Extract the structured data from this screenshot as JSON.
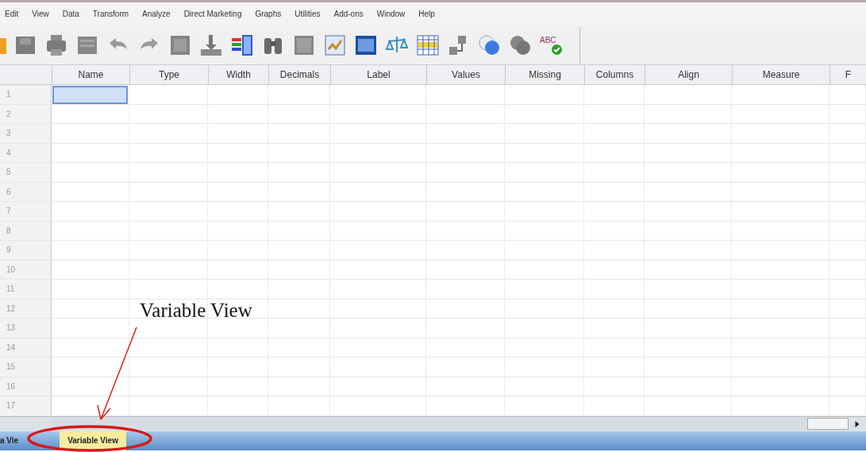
{
  "menu": [
    "Edit",
    "View",
    "Data",
    "Transform",
    "Analyze",
    "Direct Marketing",
    "Graphs",
    "Utilities",
    "Add-ons",
    "Window",
    "Help"
  ],
  "toolbar": {
    "spell_check_label": "ABC"
  },
  "columns": [
    "Name",
    "Type",
    "Width",
    "Decimals",
    "Label",
    "Values",
    "Missing",
    "Columns",
    "Align",
    "Measure",
    "F"
  ],
  "rows": [
    {
      "number": "1",
      "selected": true
    },
    {
      "number": "2",
      "selected": false
    },
    {
      "number": "3",
      "selected": false
    },
    {
      "number": "4",
      "selected": false
    },
    {
      "number": "5",
      "selected": false
    },
    {
      "number": "6",
      "selected": false
    },
    {
      "number": "7",
      "selected": false
    },
    {
      "number": "8",
      "selected": false
    },
    {
      "number": "9",
      "selected": false
    },
    {
      "number": "10",
      "selected": false
    },
    {
      "number": "11",
      "selected": false
    },
    {
      "number": "12",
      "selected": false
    },
    {
      "number": "13",
      "selected": false
    },
    {
      "number": "14",
      "selected": false
    },
    {
      "number": "15",
      "selected": false
    },
    {
      "number": "16",
      "selected": false
    },
    {
      "number": "17",
      "selected": false
    }
  ],
  "tabs": [
    {
      "label": "a Vie",
      "selected": false
    },
    {
      "label": "Variable View",
      "selected": true
    }
  ],
  "annotation": {
    "text": "Variable View"
  }
}
